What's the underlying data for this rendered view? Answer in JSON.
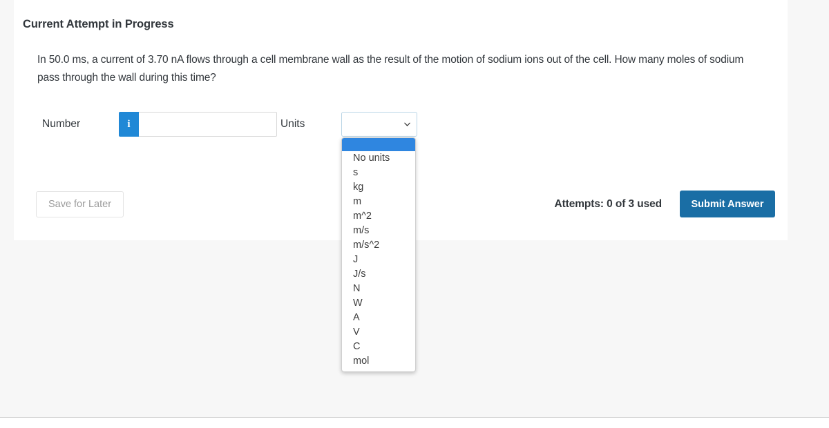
{
  "card": {
    "title": "Current Attempt in Progress",
    "question": "In 50.0 ms, a current of 3.70 nA flows through a cell membrane wall as the result of the motion of sodium ions out of the cell. How many moles of sodium pass through the wall during this time?"
  },
  "answer": {
    "number_label": "Number",
    "number_value": "",
    "number_placeholder": "",
    "info_icon": "info-icon",
    "info_glyph": "i",
    "units_label": "Units",
    "units_selected": "",
    "units_chevron": "chevron-down-icon",
    "units_options": [
      "",
      "No units",
      "s",
      "kg",
      "m",
      "m^2",
      "m/s",
      "m/s^2",
      "J",
      "J/s",
      "N",
      "W",
      "A",
      "V",
      "C",
      "mol"
    ],
    "units_dropdown_open": true
  },
  "footer": {
    "save_label": "Save for Later",
    "attempts_text": "Attempts: 0 of 3 used",
    "submit_label": "Submit Answer"
  },
  "colors": {
    "info_blue": "#2088d6",
    "submit_blue": "#1a6ea5",
    "option_highlight": "#2f86e0",
    "page_background": "#f7f7f7",
    "card_background": "#ffffff",
    "text": "#32373c"
  }
}
